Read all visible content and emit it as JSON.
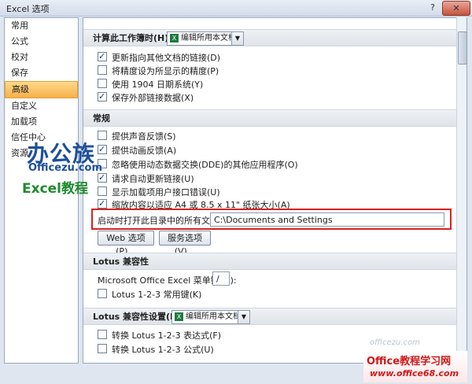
{
  "window": {
    "title": "Excel 选项",
    "help": "?",
    "close": "✕"
  },
  "sidebar": {
    "items": [
      {
        "label": "常用"
      },
      {
        "label": "公式"
      },
      {
        "label": "校对"
      },
      {
        "label": "保存"
      },
      {
        "label": "高级"
      },
      {
        "label": "自定义"
      },
      {
        "label": "加载项"
      },
      {
        "label": "信任中心"
      },
      {
        "label": "资源"
      }
    ],
    "active_index": 4
  },
  "calc": {
    "header": "计算此工作簿时(H):",
    "dropdown_value": "编辑所用本文档...",
    "options": [
      {
        "label": "更新指向其他文档的链接(D)",
        "checked": true
      },
      {
        "label": "将精度设为所显示的精度(P)",
        "checked": false
      },
      {
        "label": "使用 1904 日期系统(Y)",
        "checked": false
      },
      {
        "label": "保存外部链接数据(X)",
        "checked": true
      }
    ]
  },
  "general": {
    "header": "常规",
    "options": [
      {
        "label": "提供声音反馈(S)",
        "checked": false
      },
      {
        "label": "提供动画反馈(A)",
        "checked": true
      },
      {
        "label": "忽略使用动态数据交换(DDE)的其他应用程序(O)",
        "checked": false
      },
      {
        "label": "请求自动更新链接(U)",
        "checked": true
      },
      {
        "label": "显示加载项用户接口错误(U)",
        "checked": false
      },
      {
        "label": "缩放内容以适应 A4 或 8.5 x 11\" 纸张大小(A)",
        "checked": true
      }
    ],
    "startup_label": "启动时打开此目录中的所有文件(L):",
    "startup_value": "C:\\Documents and Settings",
    "web_button": "Web 选项(P)...",
    "service_button": "服务选项(V)..."
  },
  "lotus": {
    "header": "Lotus 兼容性",
    "menu_key_label": "Microsoft Office Excel 菜单键(M):",
    "menu_key_value": "/",
    "options": [
      {
        "label": "Lotus 1-2-3 常用键(K)",
        "checked": false
      }
    ]
  },
  "lotus_settings": {
    "header": "Lotus 兼容性设置(L):",
    "dropdown_value": "编辑所用本文档...",
    "options": [
      {
        "label": "转换 Lotus 1-2-3 表达式(F)",
        "checked": false
      },
      {
        "label": "转换 Lotus 1-2-3 公式(U)",
        "checked": false
      }
    ]
  },
  "watermarks": {
    "brand_cn": "办公族",
    "brand_url": "Officezu.com",
    "brand_tag": "Excel教程",
    "site_cn": "Office教程学习网",
    "site_url": "www.office68.com",
    "faint": "officezu.com"
  }
}
